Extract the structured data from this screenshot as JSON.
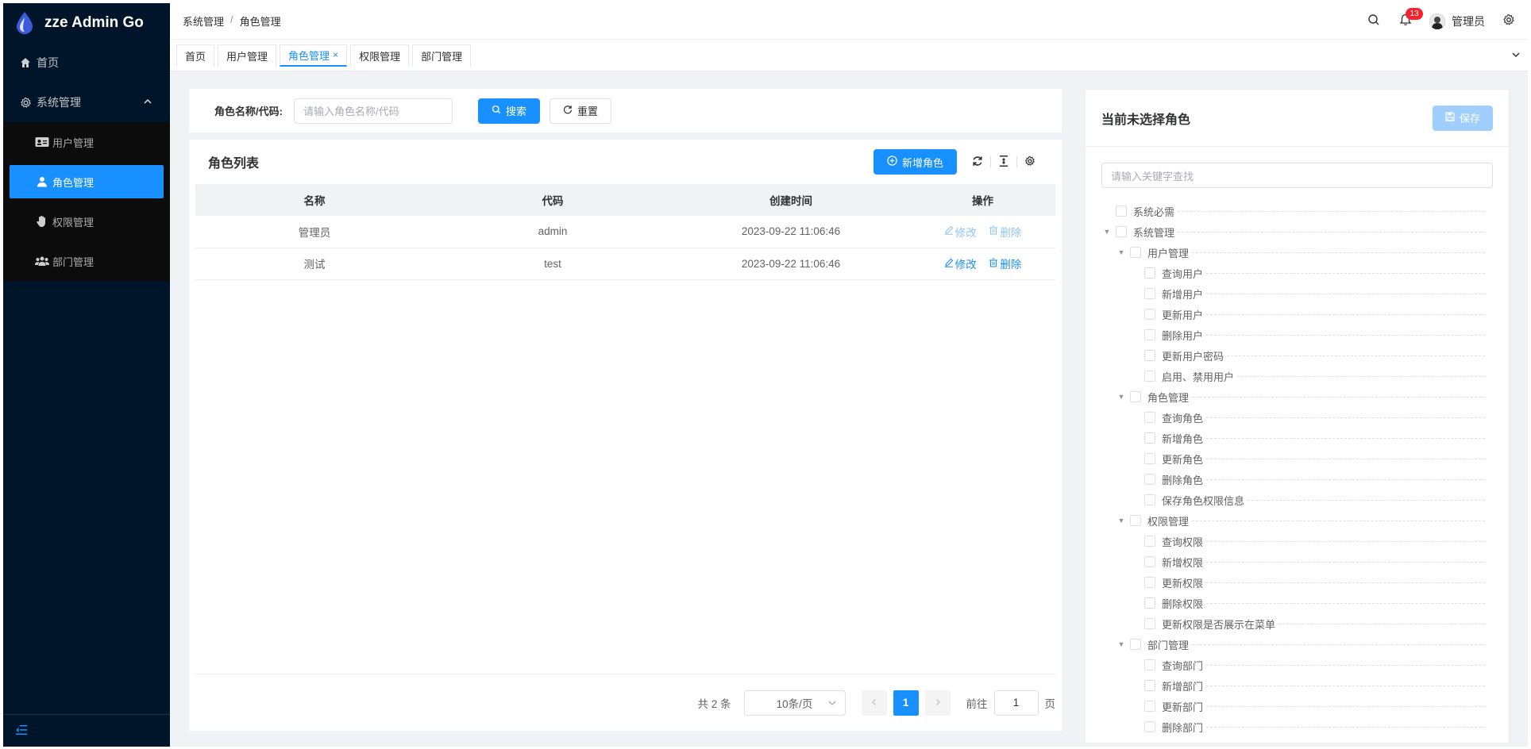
{
  "app": {
    "name": "zze Admin Go"
  },
  "sidebar": {
    "home": "首页",
    "group": "系统管理",
    "items": [
      {
        "label": "用户管理",
        "icon": "id-card-icon"
      },
      {
        "label": "角色管理",
        "icon": "user-icon"
      },
      {
        "label": "权限管理",
        "icon": "hand-icon"
      },
      {
        "label": "部门管理",
        "icon": "team-icon"
      }
    ]
  },
  "header": {
    "breadcrumb": [
      "系统管理",
      "角色管理"
    ],
    "notification_count": "13",
    "username": "管理员"
  },
  "tabs": [
    {
      "label": "首页"
    },
    {
      "label": "用户管理"
    },
    {
      "label": "角色管理",
      "close": "×"
    },
    {
      "label": "权限管理"
    },
    {
      "label": "部门管理"
    }
  ],
  "search": {
    "label": "角色名称/代码:",
    "placeholder": "请输入角色名称/代码",
    "search_btn": "搜索",
    "reset_btn": "重置"
  },
  "table": {
    "title": "角色列表",
    "add_btn": "新增角色",
    "columns": [
      "名称",
      "代码",
      "创建时间",
      "操作"
    ],
    "rows": [
      {
        "name": "管理员",
        "code": "admin",
        "created": "2023-09-22 11:06:46",
        "edit": "修改",
        "delete": "删除"
      },
      {
        "name": "测试",
        "code": "test",
        "created": "2023-09-22 11:06:46",
        "edit": "修改",
        "delete": "删除"
      }
    ]
  },
  "pagination": {
    "total": "共 2 条",
    "page_size": "10条/页",
    "current": "1",
    "goto_label": "前往",
    "goto_value": "1",
    "page_suffix": "页"
  },
  "permissions": {
    "title": "当前未选择角色",
    "save_btn": "保存",
    "search_placeholder": "请输入关键字查找",
    "tree": [
      {
        "label": "系统必需",
        "children": []
      },
      {
        "label": "系统管理",
        "children": [
          {
            "label": "用户管理",
            "children": [
              "查询用户",
              "新增用户",
              "更新用户",
              "删除用户",
              "更新用户密码",
              "启用、禁用用户"
            ]
          },
          {
            "label": "角色管理",
            "children": [
              "查询角色",
              "新增角色",
              "更新角色",
              "删除角色",
              "保存角色权限信息"
            ]
          },
          {
            "label": "权限管理",
            "children": [
              "查询权限",
              "新增权限",
              "更新权限",
              "删除权限",
              "更新权限是否展示在菜单"
            ]
          },
          {
            "label": "部门管理",
            "children": [
              "查询部门",
              "新增部门",
              "更新部门",
              "删除部门"
            ]
          }
        ]
      }
    ]
  },
  "colors": {
    "primary": "#1890ff",
    "sidebar_bg": "#001529",
    "submenu_bg": "#0c0c0c",
    "badge": "#f5222d",
    "disabled_primary": "#a0cfff"
  }
}
